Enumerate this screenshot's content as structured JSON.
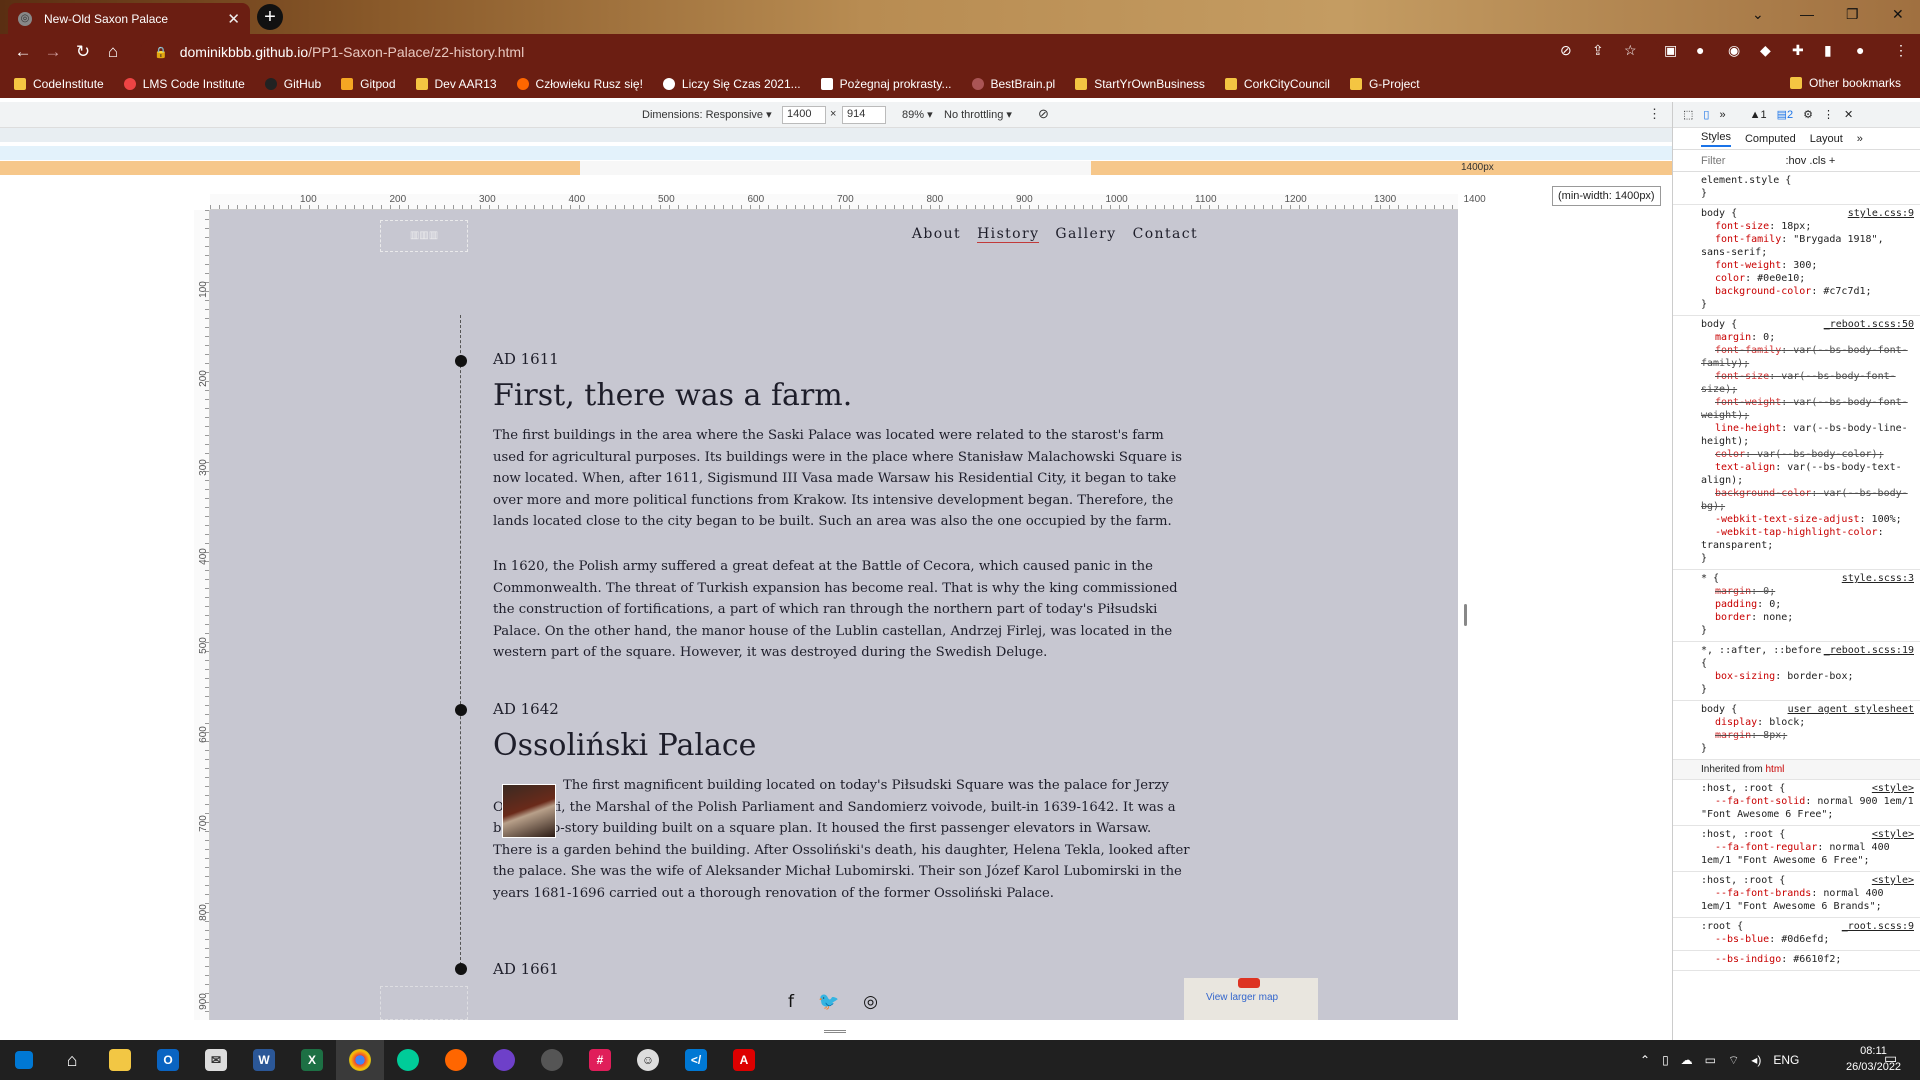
{
  "browser": {
    "tab_title": "New-Old Saxon Palace",
    "url_domain": "dominikbbb.github.io",
    "url_path": "/PP1-Saxon-Palace/z2-history.html",
    "bookmarks": [
      "CodeInstitute",
      "LMS Code Institute",
      "GitHub",
      "Gitpod",
      "Dev AAR13",
      "Człowieku Rusz się!",
      "Liczy Się Czas 2021...",
      "Pożegnaj prokrasty...",
      "BestBrain.pl",
      "StartYrOwnBusiness",
      "CorkCityCouncil",
      "G-Project"
    ],
    "other_bookmarks": "Other bookmarks"
  },
  "device_toolbar": {
    "dimensions_label": "Dimensions: Responsive",
    "width": "1400",
    "height": "914",
    "times": "×",
    "zoom": "89%",
    "throttle": "No throttling",
    "mq_label": "1400px",
    "min_width_tooltip": "(min-width: 1400px)"
  },
  "ruler": {
    "h_labels": [
      "100",
      "200",
      "300",
      "400",
      "500",
      "600",
      "700",
      "800",
      "900",
      "1000",
      "1100",
      "1200",
      "1300",
      "1400"
    ],
    "v_labels": [
      "100",
      "200",
      "300",
      "400",
      "500",
      "600",
      "700",
      "800",
      "900"
    ]
  },
  "site": {
    "nav": [
      "About",
      "History",
      "Gallery",
      "Contact"
    ],
    "active_nav": "History",
    "sections": [
      {
        "year": "AD 1611",
        "heading": "First, there was a farm.",
        "paragraphs": [
          "The first buildings in the area where the Saski Palace was located were related to the starost's farm used for agricultural purposes. Its buildings were in the place where Stanisław Malachowski Square is now located. When, after 1611, Sigismund III Vasa made Warsaw his Residential City, it began to take over more and more political functions from Krakow. Its intensive development began. Therefore, the lands located close to the city began to be built. Such an area was also the one occupied by the farm.",
          "In 1620, the Polish army suffered a great defeat at the Battle of Cecora, which caused panic in the Commonwealth. The threat of Turkish expansion has become real. That is why the king commissioned the construction of fortifications, a part of which ran through the northern part of today's Piłsudski Palace. On the other hand, the manor house of the Lublin castellan, Andrzej Firlej, was located in the western part of the square. However, it was destroyed during the Swedish Deluge."
        ]
      },
      {
        "year": "AD 1642",
        "heading": "Ossoliński Palace",
        "paragraphs": [
          "The first magnificent building located on today's Piłsudski Square was the palace for Jerzy Ossoliński, the Marshal of the Polish Parliament and Sandomierz voivode, built-in 1639-1642. It was a brick, two-story building built on a square plan. It housed the first passenger elevators in Warsaw. There is a garden behind the building. After Ossoliński's death, his daughter, Helena Tekla, looked after the palace. She was the wife of Aleksander Michał Lubomirski. Their son Józef Karol Lubomirski in the years 1681-1696 carried out a thorough renovation of the former Ossoliński Palace."
        ]
      },
      {
        "year": "AD 1661"
      }
    ],
    "map_link": "View larger map",
    "social_icons": [
      "facebook-icon",
      "twitter-icon",
      "instagram-icon"
    ]
  },
  "devtools": {
    "tabs": [
      "Styles",
      "Computed",
      "Layout"
    ],
    "filter_placeholder": "Filter",
    "hov": ":hov",
    "cls": ".cls",
    "warn_count": "1",
    "msg_count": "2",
    "rules": [
      {
        "selector": "element.style {",
        "source": "",
        "props": []
      },
      {
        "selector": "body {",
        "source": "style.css:9",
        "props": [
          [
            "font-size",
            "18px;"
          ],
          [
            "font-family",
            "\"Brygada 1918\", sans-serif;"
          ],
          [
            "font-weight",
            "300;"
          ],
          [
            "color",
            "#0e0e10;"
          ],
          [
            "background-color",
            "#c7c7d1;"
          ]
        ]
      },
      {
        "selector": "body {",
        "source": "_reboot.scss:50",
        "props": [
          [
            "margin",
            "0;"
          ],
          [
            "font-family",
            "var(--bs-body-font-family);"
          ],
          [
            "font-size",
            "var(--bs-body-font-size);"
          ],
          [
            "font-weight",
            "var(--bs-body-font-weight);"
          ],
          [
            "line-height",
            "var(--bs-body-line-height);"
          ],
          [
            "color",
            "var(--bs-body-color);"
          ],
          [
            "text-align",
            "var(--bs-body-text-align);"
          ],
          [
            "background-color",
            "var(--bs-body-bg);"
          ],
          [
            "-webkit-text-size-adjust",
            "100%;"
          ],
          [
            "-webkit-tap-highlight-color",
            "transparent;"
          ]
        ]
      },
      {
        "selector": "* {",
        "source": "style.scss:3",
        "props": [
          [
            "margin",
            "0;"
          ],
          [
            "padding",
            "0;"
          ],
          [
            "border",
            "none;"
          ]
        ]
      },
      {
        "selector": "*, ::after, ::before {",
        "source": "_reboot.scss:19",
        "props": [
          [
            "box-sizing",
            "border-box;"
          ]
        ]
      },
      {
        "selector": "body {",
        "source": "user agent stylesheet",
        "props": [
          [
            "display",
            "block;"
          ],
          [
            "margin",
            "8px;"
          ]
        ]
      }
    ],
    "inherited_label": "Inherited from",
    "inherited_from": "html",
    "root_rules": [
      {
        "selector": ":host, :root {",
        "source": "<style>",
        "prop": "--fa-font-solid",
        "value": "normal 900 1em/1 \"Font Awesome 6 Free\";"
      },
      {
        "selector": ":host, :root {",
        "source": "<style>",
        "prop": "--fa-font-regular",
        "value": "normal 400 1em/1 \"Font Awesome 6 Free\";"
      },
      {
        "selector": ":host, :root {",
        "source": "<style>",
        "prop": "--fa-font-brands",
        "value": "normal 400 1em/1 \"Font Awesome 6 Brands\";"
      },
      {
        "selector": ":root {",
        "source": "_root.scss:9",
        "prop": "--bs-blue",
        "value": "#0d6efd;"
      },
      {
        "selector": "",
        "source": "",
        "prop": "--bs-indigo",
        "value": "#6610f2;"
      }
    ]
  },
  "taskbar": {
    "lang": "ENG",
    "time": "08:11",
    "date": "26/03/2022"
  },
  "colors": {
    "chrome_red": "#6b1e12",
    "page_bg": "#c7c7d1",
    "text": "#0e0e10",
    "nav_underline": "#c23a3a"
  }
}
